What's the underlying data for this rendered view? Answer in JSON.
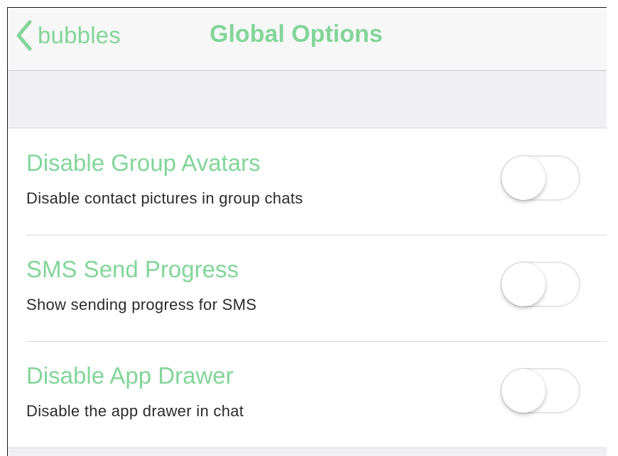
{
  "nav": {
    "back_label": "bubbles",
    "title": "Global Options",
    "back_icon": "chevron-left-icon"
  },
  "settings": {
    "items": [
      {
        "title": "Disable Group Avatars",
        "subtitle": "Disable contact pictures in group chats",
        "enabled": false
      },
      {
        "title": "SMS Send Progress",
        "subtitle": "Show sending progress for SMS",
        "enabled": false
      },
      {
        "title": "Disable App Drawer",
        "subtitle": "Disable the app drawer in chat",
        "enabled": false
      }
    ]
  },
  "colors": {
    "accent": "#82d59a",
    "text": "#2b2b2b",
    "separator": "#d9d9de",
    "group_background": "#efeff4"
  }
}
